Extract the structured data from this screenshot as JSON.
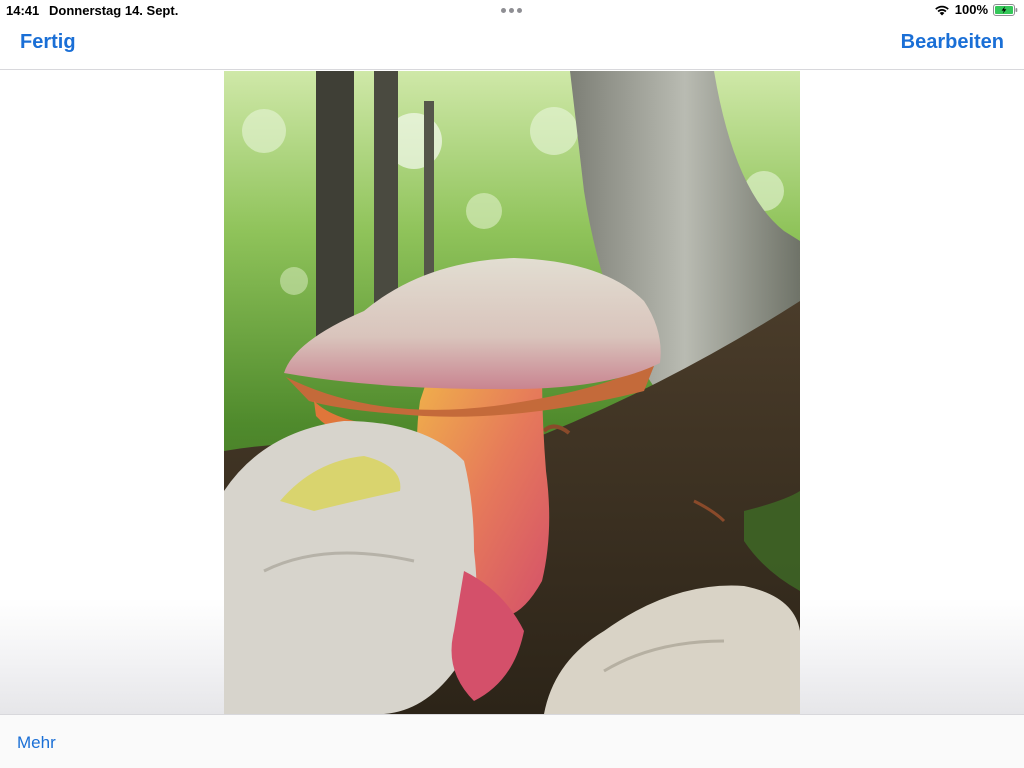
{
  "status_bar": {
    "time": "14:41",
    "date": "Donnerstag 14. Sept.",
    "battery_percent": "100%",
    "wifi_icon": "wifi-icon",
    "battery_icon": "battery-charging-icon"
  },
  "nav": {
    "done_label": "Fertig",
    "edit_label": "Bearbeiten"
  },
  "toolbar": {
    "more_label": "Mehr"
  },
  "colors": {
    "accent": "#1a6fd6"
  }
}
